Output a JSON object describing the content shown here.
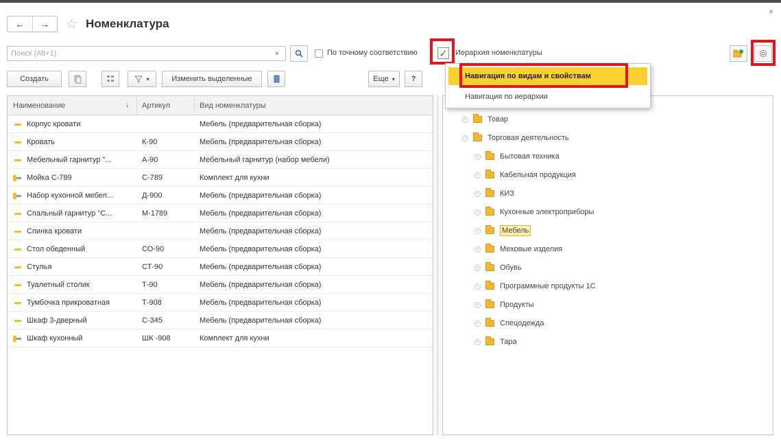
{
  "window": {
    "title": "Номенклатура",
    "back_symbol": "←",
    "forward_symbol": "→",
    "close_symbol": "×"
  },
  "search": {
    "placeholder": "Поиск (Alt+1)",
    "value": "",
    "clear_symbol": "×",
    "exact_match_label": "По точному соответствию"
  },
  "hierarchy_toggle": {
    "label": "Иерархия номенклатуры",
    "checked": true
  },
  "toolbar": {
    "create_label": "Создать",
    "edit_selected_label": "Изменить выделенные",
    "more_label": "Еще",
    "help_label": "?"
  },
  "dropdown": {
    "items": [
      "Навигация по видам и свойствам",
      "Навигация по иерархии"
    ],
    "selected_index": 0
  },
  "table": {
    "columns": [
      "Наименование",
      "Артикул",
      "Вид номенклатуры"
    ],
    "sort_indicator": "↓",
    "rows": [
      {
        "name": "Корпус кровати",
        "article": "",
        "kind": "Мебель (предварительная сборка)",
        "icon": "item"
      },
      {
        "name": "Кровать",
        "article": "К-90",
        "kind": "Мебель (предварительная сборка)",
        "icon": "item"
      },
      {
        "name": "Мебельный гарнитур \"...",
        "article": "А-90",
        "kind": "Мебельный гарнитур (набор мебели)",
        "icon": "item"
      },
      {
        "name": "Мойка С-789",
        "article": "С-789",
        "kind": "Комплект для кухни",
        "icon": "set"
      },
      {
        "name": "Набор кухонной мебел...",
        "article": "Д-900",
        "kind": "Мебель (предварительная сборка)",
        "icon": "set"
      },
      {
        "name": "Спальный гарнитур \"С...",
        "article": "М-1789",
        "kind": "Мебель (предварительная сборка)",
        "icon": "item"
      },
      {
        "name": "Спинка кровати",
        "article": "",
        "kind": "Мебель (предварительная сборка)",
        "icon": "item"
      },
      {
        "name": "Стол обеденный",
        "article": "СО-90",
        "kind": "Мебель (предварительная сборка)",
        "icon": "item"
      },
      {
        "name": "Стулья",
        "article": "СТ-90",
        "kind": "Мебель (предварительная сборка)",
        "icon": "item"
      },
      {
        "name": "Туалетный столик",
        "article": "Т-90",
        "kind": "Мебель (предварительная сборка)",
        "icon": "item"
      },
      {
        "name": "Тумбочка прикроватная",
        "article": "Т-908",
        "kind": "Мебель (предварительная сборка)",
        "icon": "item"
      },
      {
        "name": "Шкаф 3-дверный",
        "article": "С-345",
        "kind": "Мебель (предварительная сборка)",
        "icon": "item"
      },
      {
        "name": "Шкаф кухонный",
        "article": "ШК -908",
        "kind": "Комплект для кухни",
        "icon": "set"
      }
    ]
  },
  "tree": {
    "nodes": [
      {
        "label": "Товар",
        "level": 0
      },
      {
        "label": "Торговая деятельность",
        "level": 0
      },
      {
        "label": "Бытовая техника",
        "level": 1
      },
      {
        "label": "Кабельная продукция",
        "level": 1
      },
      {
        "label": "КИЗ",
        "level": 1
      },
      {
        "label": "Кухонные электроприборы",
        "level": 1
      },
      {
        "label": "Мебель",
        "level": 1,
        "selected": true
      },
      {
        "label": "Меховые изделия",
        "level": 1
      },
      {
        "label": "Обувь",
        "level": 1
      },
      {
        "label": "Программные продукты 1С",
        "level": 1
      },
      {
        "label": "Продукты",
        "level": 1
      },
      {
        "label": "Спецодежда",
        "level": 1
      },
      {
        "label": "Тара",
        "level": 1
      }
    ]
  },
  "colors": {
    "highlight": "#e8141b",
    "menu_selected": "#fbd12f",
    "check": "#1e9a2b",
    "folder": "#f2b92e"
  }
}
